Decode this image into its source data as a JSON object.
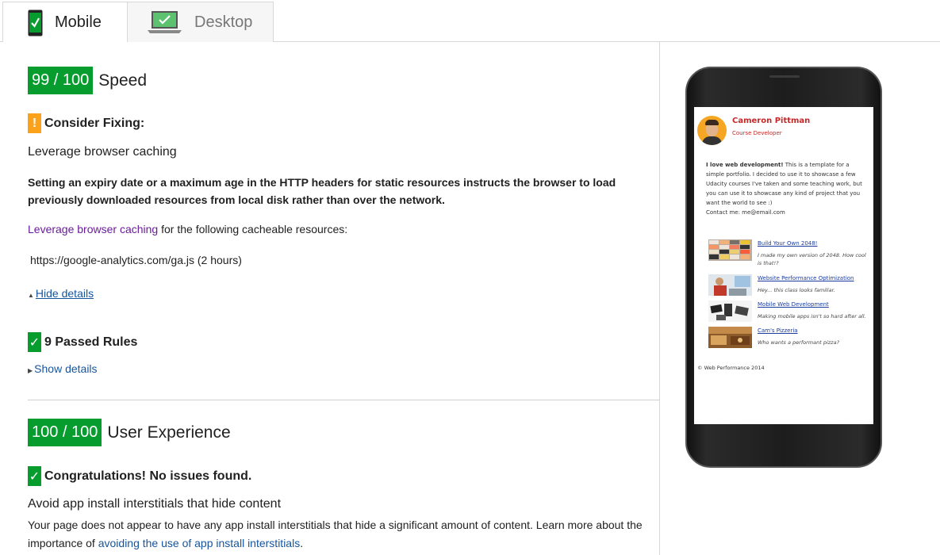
{
  "tabs": {
    "mobile": "Mobile",
    "desktop": "Desktop"
  },
  "speed": {
    "score": "99 / 100",
    "title": "Speed",
    "consider_fixing": "Consider Fixing:",
    "rule_name": "Leverage browser caching",
    "description": "Setting an expiry date or a maximum age in the HTTP headers for static resources instructs the browser to load previously downloaded resources from local disk rather than over the network.",
    "link_text": "Leverage browser caching",
    "link_suffix": " for the following cacheable resources:",
    "resource": "https://google-analytics.com/ga.js (2 hours)",
    "hide_details": "Hide details",
    "passed_rules": "9 Passed Rules",
    "show_details": "Show details"
  },
  "ux": {
    "score": "100 / 100",
    "title": "User Experience",
    "congrats": "Congratulations! No issues found.",
    "rule_name": "Avoid app install interstitials that hide content",
    "desc_prefix": "Your page does not appear to have any app install interstitials that hide a significant amount of content. Learn more about the importance of ",
    "desc_link": "avoiding the use of app install interstitials",
    "desc_suffix": "."
  },
  "preview": {
    "name": "Cameron Pittman",
    "role": "Course Developer",
    "bio_bold": "I love web development!",
    "bio_rest": " This is a template for a simple portfolio. I decided to use it to showcase a few Udacity courses I've taken and some teaching work, but you can use it to showcase any kind of project that you want the world to see :)",
    "contact": "Contact me: me@email.com",
    "projects": [
      {
        "title": "Build Your Own 2048!",
        "desc": "I made my own version of 2048. How cool is that!?"
      },
      {
        "title": "Website Performance Optimization",
        "desc": "Hey... this class looks familiar."
      },
      {
        "title": "Mobile Web Development",
        "desc": "Making mobile apps isn't so hard after all."
      },
      {
        "title": "Cam's Pizzeria",
        "desc": "Who wants a performant pizza?"
      }
    ],
    "footer": "© Web Performance 2014"
  },
  "colors": {
    "pass_green": "#079d2e",
    "warn_orange": "#f9a21a",
    "link_blue": "#15559e",
    "link_purple": "#6a1b9a"
  }
}
